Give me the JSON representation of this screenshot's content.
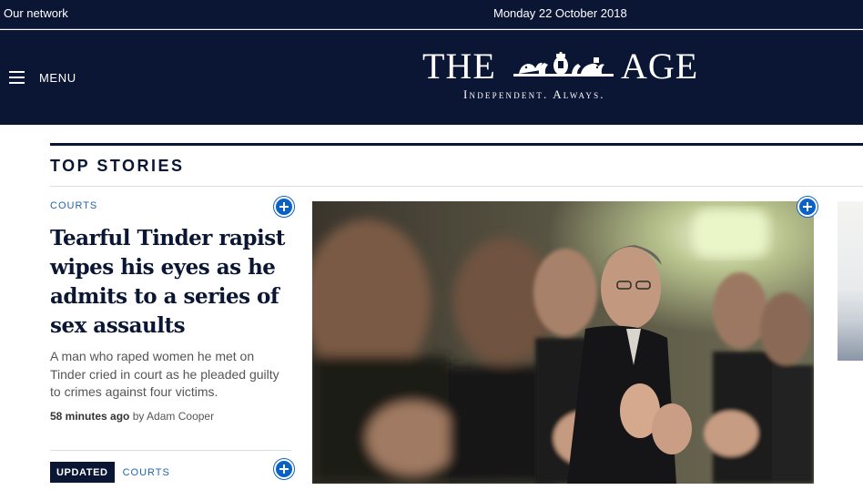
{
  "topbar": {
    "network_label": "Our network",
    "date": "Monday 22 October 2018"
  },
  "masthead": {
    "menu_label": "MENU",
    "logo_word_left": "THE",
    "logo_word_right": "AGE",
    "tagline": "Independent. Always."
  },
  "section": {
    "title": "TOP STORIES"
  },
  "lead_story": {
    "kicker": "COURTS",
    "headline": "Tearful Tinder rapist wipes his eyes as he admits to a series of sex assaults",
    "summary": "A man who raped women he met on Tinder cried in court as he pleaded guilty to crimes against four victims.",
    "time_ago": "58 minutes ago",
    "byline": "by Adam Cooper"
  },
  "second_story": {
    "badge": "UPDATED",
    "kicker": "COURTS"
  },
  "colors": {
    "navy": "#0a1633",
    "link_blue": "#2066ad",
    "button_blue": "#0b62c4"
  },
  "icons": {
    "menu": "hamburger-icon",
    "save": "plus-circle-icon",
    "logo_crest": "coat-of-arms-icon"
  }
}
